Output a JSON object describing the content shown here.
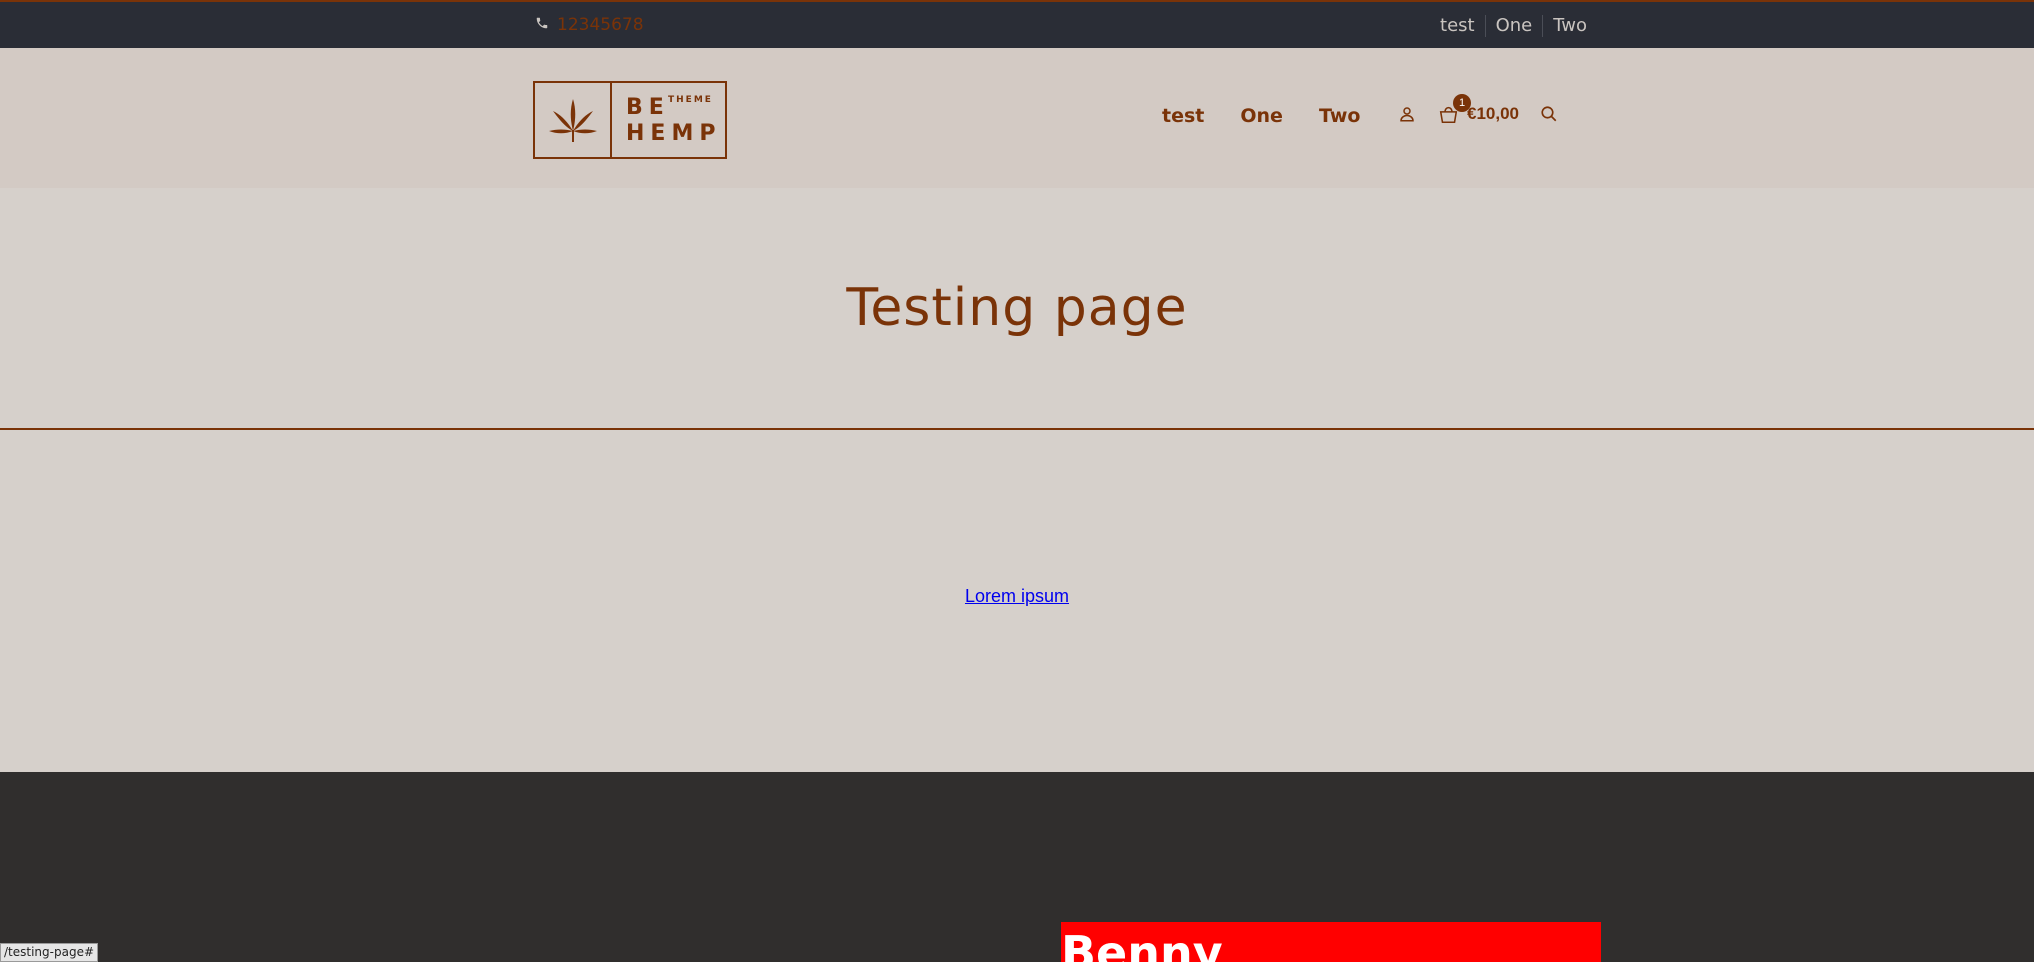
{
  "topbar": {
    "phone_icon": "phone-icon",
    "phone": "12345678",
    "links": [
      "test",
      "One",
      "Two"
    ]
  },
  "logo": {
    "icon": "cannabis-leaf-icon",
    "line1": "BE",
    "small": "THEME",
    "line2": "HEMP"
  },
  "nav": {
    "items": [
      "test",
      "One",
      "Two"
    ]
  },
  "header_icons": {
    "user_icon": "user-icon",
    "cart_icon": "shopping-bag-icon",
    "cart_count": "1",
    "cart_total": "€10,00",
    "search_icon": "search-icon"
  },
  "page": {
    "title": "Testing page",
    "link_text": "Lorem ipsum"
  },
  "footer": {
    "red_box_text": "Benny"
  },
  "status_bar": {
    "url": "/testing-page#"
  },
  "colors": {
    "accent": "#7a3308",
    "topbar_bg": "#2a2d36",
    "header_bg": "#d3cac4",
    "page_bg": "#d6d0cb",
    "footer_bg": "#302e2d",
    "red_box": "#ff0000",
    "link": "#0000ee"
  }
}
